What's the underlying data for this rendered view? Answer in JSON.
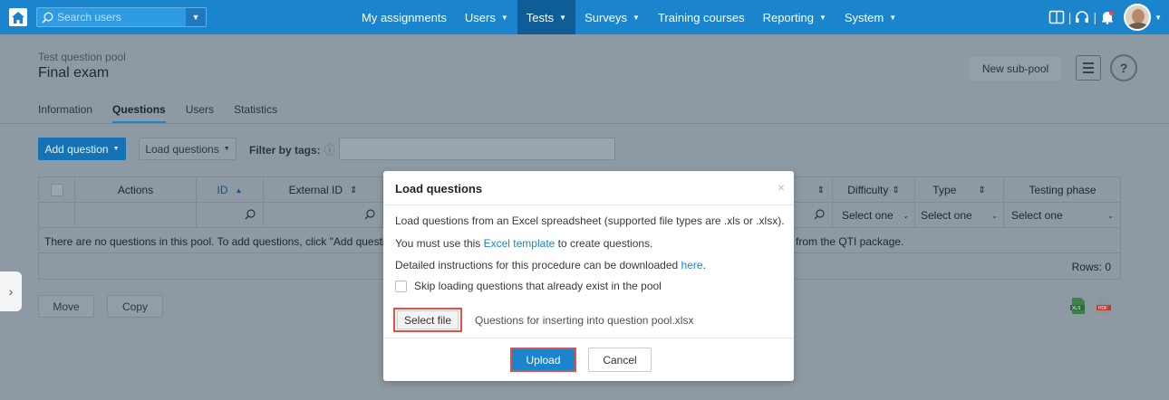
{
  "nav": {
    "search_placeholder": "Search users",
    "items": [
      {
        "label": "My assignments",
        "dropdown": false,
        "active": false
      },
      {
        "label": "Users",
        "dropdown": true,
        "active": false
      },
      {
        "label": "Tests",
        "dropdown": true,
        "active": true
      },
      {
        "label": "Surveys",
        "dropdown": true,
        "active": false
      },
      {
        "label": "Training courses",
        "dropdown": false,
        "active": false
      },
      {
        "label": "Reporting",
        "dropdown": true,
        "active": false
      },
      {
        "label": "System",
        "dropdown": true,
        "active": false
      }
    ],
    "icons": [
      "book-icon",
      "headset-icon",
      "bell-icon"
    ]
  },
  "header": {
    "subtitle": "Test question pool",
    "title": "Final exam",
    "new_subpool": "New sub-pool",
    "help": "?"
  },
  "tabs": [
    {
      "label": "Information",
      "active": false
    },
    {
      "label": "Questions",
      "active": true
    },
    {
      "label": "Users",
      "active": false
    },
    {
      "label": "Statistics",
      "active": false
    }
  ],
  "toolbar": {
    "add_question": "Add question",
    "load_questions": "Load questions",
    "filter_label": "Filter by tags:",
    "filter_value": ""
  },
  "table": {
    "columns": [
      "",
      "Actions",
      "ID",
      "External ID",
      "",
      "Difficulty",
      "Type",
      "Testing phase"
    ],
    "filter_placeholders": {
      "difficulty": "Select one",
      "type": "Select one",
      "phase": "Select one"
    },
    "empty_message": "There are no questions in this pool. To add questions, click \"Add question\"",
    "empty_message_tail": "from the QTI package.",
    "rows_label": "Rows: 0"
  },
  "actions": {
    "move": "Move",
    "copy": "Copy"
  },
  "modal": {
    "title": "Load questions",
    "close": "×",
    "line1": "Load questions from an Excel spreadsheet (supported file types are .xls or .xlsx).",
    "line2_pre": "You must use this ",
    "line2_link": "Excel template",
    "line2_post": " to create questions.",
    "line3_pre": "Detailed instructions for this procedure can be downloaded ",
    "line3_link": "here",
    "line3_post": ".",
    "checkbox_label": "Skip loading questions that already exist in the pool",
    "select_file": "Select file",
    "file_name": "Questions for inserting into question pool.xlsx",
    "upload": "Upload",
    "cancel": "Cancel"
  },
  "colors": {
    "accent": "#1a84cc",
    "highlight": "#d9534f"
  }
}
